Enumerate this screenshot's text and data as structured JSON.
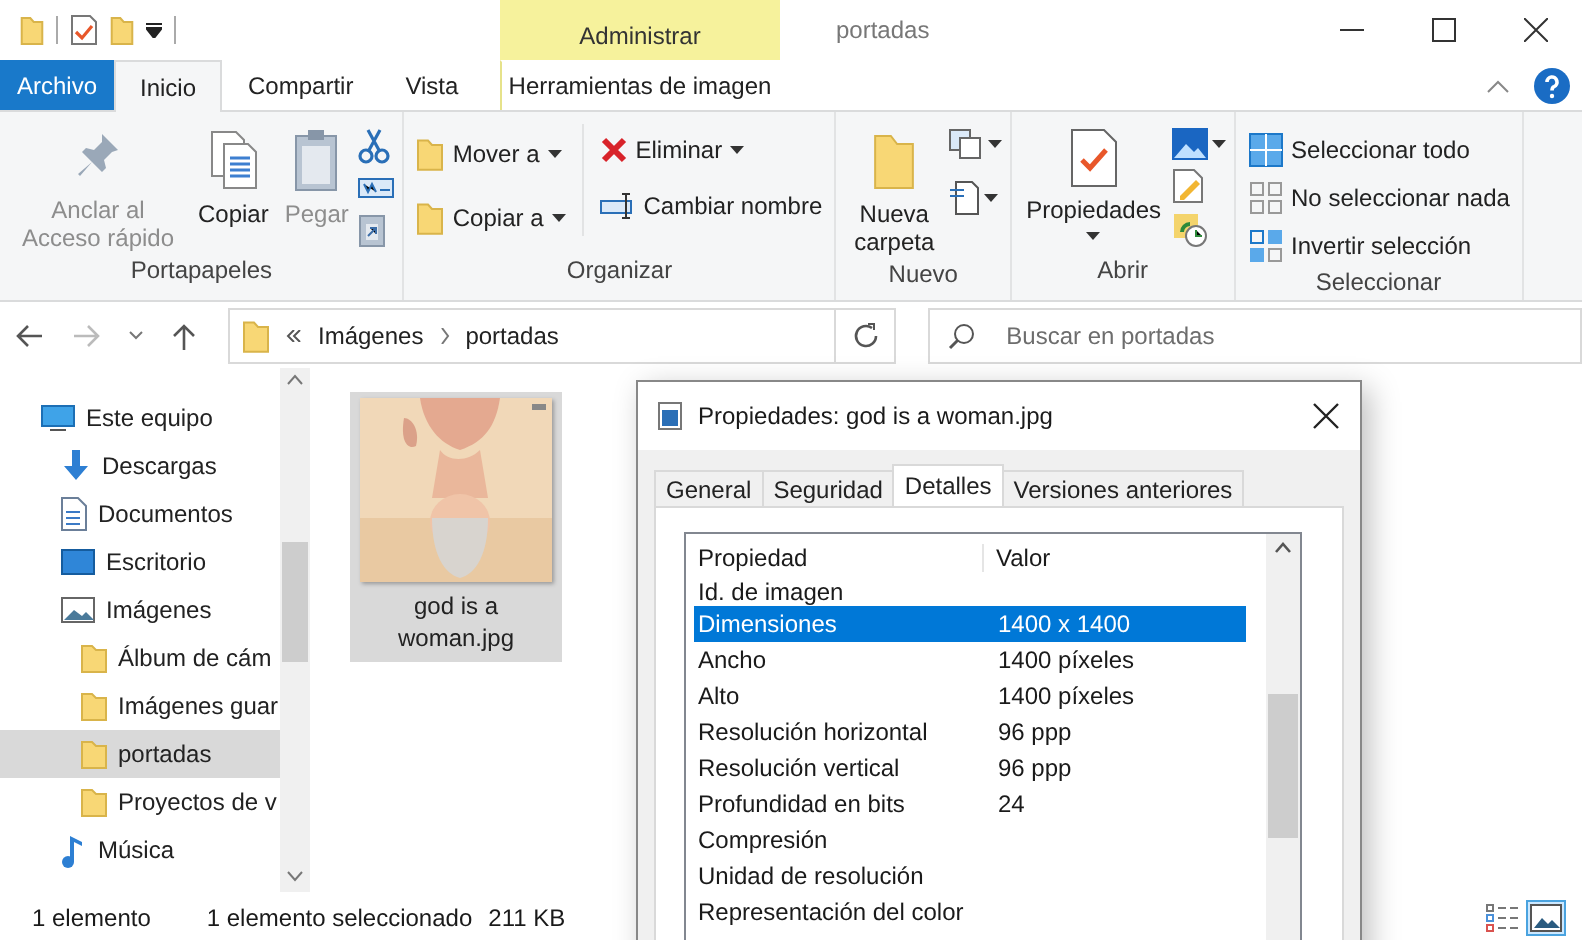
{
  "window": {
    "title": "portadas",
    "context_label": "Administrar"
  },
  "tabs": [
    {
      "label": "Archivo",
      "kind": "file",
      "selected": false
    },
    {
      "label": "Inicio",
      "kind": "tab",
      "selected": true
    },
    {
      "label": "Compartir",
      "kind": "tab",
      "selected": false
    },
    {
      "label": "Vista",
      "kind": "tab",
      "selected": false
    },
    {
      "label": "Herramientas de imagen",
      "kind": "context",
      "selected": false
    }
  ],
  "ribbon": {
    "groups": [
      {
        "label": "Portapapeles",
        "buttons": [
          {
            "label": "Anclar al Acceso rápido",
            "disabled": true
          },
          {
            "label": "Copiar",
            "disabled": false
          },
          {
            "label": "Pegar",
            "disabled": true
          }
        ]
      },
      {
        "label": "Organizar",
        "buttons": [
          {
            "label": "Mover a",
            "disabled": false
          },
          {
            "label": "Copiar a",
            "disabled": false
          },
          {
            "label": "Eliminar",
            "disabled": false
          },
          {
            "label": "Cambiar nombre",
            "disabled": false
          }
        ]
      },
      {
        "label": "Nuevo",
        "buttons": [
          {
            "label": "Nueva carpeta",
            "disabled": false
          }
        ]
      },
      {
        "label": "Abrir",
        "buttons": [
          {
            "label": "Propiedades",
            "disabled": false
          }
        ]
      },
      {
        "label": "Seleccionar",
        "buttons": [
          {
            "label": "Seleccionar todo",
            "disabled": false
          },
          {
            "label": "No seleccionar nada",
            "disabled": false
          },
          {
            "label": "Invertir selección",
            "disabled": false
          }
        ]
      }
    ]
  },
  "address": {
    "crumbs": [
      "Imágenes",
      "portadas"
    ]
  },
  "search": {
    "placeholder": "Buscar en portadas"
  },
  "sidebar": {
    "items": [
      {
        "label": "Este equipo",
        "selected": false,
        "children": [
          {
            "label": "Descargas",
            "selected": false
          },
          {
            "label": "Documentos",
            "selected": false
          },
          {
            "label": "Escritorio",
            "selected": false
          },
          {
            "label": "Imágenes",
            "selected": false,
            "children": [
              {
                "label": "Álbum de cám",
                "selected": false
              },
              {
                "label": "Imágenes guar",
                "selected": false
              },
              {
                "label": "portadas",
                "selected": true
              },
              {
                "label": "Proyectos de v",
                "selected": false
              }
            ]
          },
          {
            "label": "Música",
            "selected": false
          }
        ]
      }
    ]
  },
  "files": [
    {
      "name": "god is a woman.jpg",
      "selected": true,
      "kind": "picture"
    }
  ],
  "status_bar": {
    "count": "1 elemento",
    "selection": "1 elemento seleccionado",
    "size": "211 KB",
    "views": [
      {
        "selected": false
      },
      {
        "selected": true
      }
    ]
  },
  "dialog": {
    "title": "Propiedades: god is a woman.jpg",
    "tabs": [
      {
        "label": "General",
        "selected": false
      },
      {
        "label": "Seguridad",
        "selected": false
      },
      {
        "label": "Detalles",
        "selected": true
      },
      {
        "label": "Versiones anteriores",
        "selected": false
      }
    ],
    "columns": [
      "Propiedad",
      "Valor"
    ],
    "rows": [
      {
        "property": "Id. de imagen",
        "value": "",
        "selected": false
      },
      {
        "property": "Dimensiones",
        "value": "1400 x 1400",
        "selected": true
      },
      {
        "property": "Ancho",
        "value": "1400 píxeles",
        "selected": false
      },
      {
        "property": "Alto",
        "value": "1400 píxeles",
        "selected": false
      },
      {
        "property": "Resolución horizontal",
        "value": "96 ppp",
        "selected": false
      },
      {
        "property": "Resolución vertical",
        "value": "96 ppp",
        "selected": false
      },
      {
        "property": "Profundidad en bits",
        "value": "24",
        "selected": false
      },
      {
        "property": "Compresión",
        "value": "",
        "selected": false
      },
      {
        "property": "Unidad de resolución",
        "value": "",
        "selected": false
      },
      {
        "property": "Representación del color",
        "value": "",
        "selected": false
      }
    ]
  }
}
